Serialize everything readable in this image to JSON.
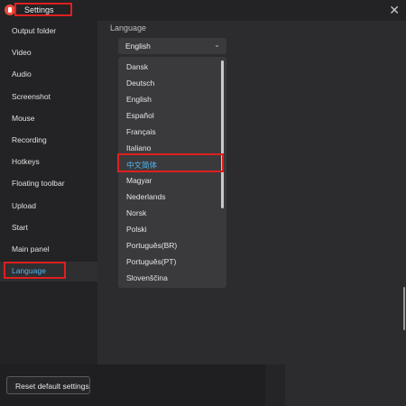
{
  "window": {
    "title": "Settings",
    "close_glyph": "✕"
  },
  "sidebar": {
    "items": [
      {
        "label": "Output folder"
      },
      {
        "label": "Video"
      },
      {
        "label": "Audio"
      },
      {
        "label": "Screenshot"
      },
      {
        "label": "Mouse"
      },
      {
        "label": "Recording"
      },
      {
        "label": "Hotkeys"
      },
      {
        "label": "Floating toolbar"
      },
      {
        "label": "Upload"
      },
      {
        "label": "Start"
      },
      {
        "label": "Main panel"
      },
      {
        "label": "Language",
        "active": true
      }
    ]
  },
  "language": {
    "section_title": "Language",
    "selected": "English",
    "chevron": "⌄",
    "options": [
      {
        "label": "Dansk"
      },
      {
        "label": "Deutsch"
      },
      {
        "label": "English"
      },
      {
        "label": "Español"
      },
      {
        "label": "Français"
      },
      {
        "label": "Italiano"
      },
      {
        "label": "中文简体",
        "highlighted": true
      },
      {
        "label": "Magyar"
      },
      {
        "label": "Nederlands"
      },
      {
        "label": "Norsk"
      },
      {
        "label": "Polski"
      },
      {
        "label": "Português(BR)"
      },
      {
        "label": "Português(PT)"
      },
      {
        "label": "Slovenščina"
      }
    ]
  },
  "footer": {
    "reset_label": "Reset default settings"
  },
  "colors": {
    "accent": "#52b6ee",
    "highlight_box": "#e01f1f",
    "logo": "#e84c3d"
  }
}
